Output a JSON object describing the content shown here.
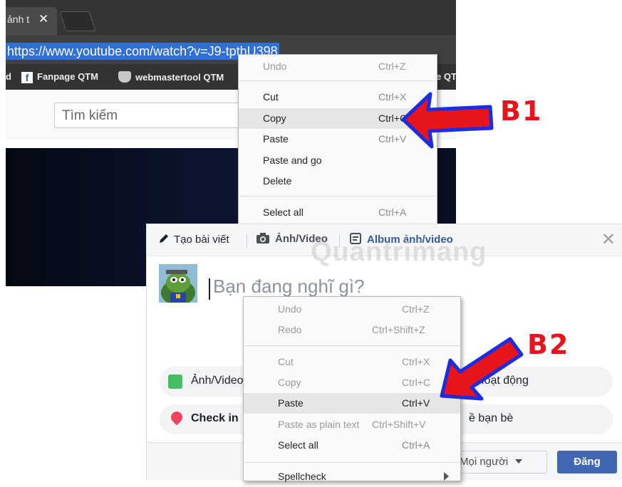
{
  "browser": {
    "tab_title": "ảnh t",
    "tab_close": "✕",
    "url": "https://www.youtube.com/watch?v=J9-tpthU398",
    "bookmarks": [
      {
        "label": "d"
      },
      {
        "label": "Fanpage QTM"
      },
      {
        "label": "webmastertool QTM"
      },
      {
        "label": "e QT"
      }
    ],
    "youtube_search_placeholder": "Tìm kiếm"
  },
  "menu1": {
    "items": {
      "undo": {
        "label": "Undo",
        "shortcut": "Ctrl+Z"
      },
      "cut": {
        "label": "Cut",
        "shortcut": "Ctrl+X"
      },
      "copy": {
        "label": "Copy",
        "shortcut": "Ctrl+C"
      },
      "paste": {
        "label": "Paste",
        "shortcut": "Ctrl+V"
      },
      "paste_go": {
        "label": "Paste and go"
      },
      "delete": {
        "label": "Delete"
      },
      "select_all": {
        "label": "Select all",
        "shortcut": "Ctrl+A"
      }
    }
  },
  "composer": {
    "tab_post": "Tạo bài viết",
    "tab_photo": "Ảnh/Video",
    "tab_album": "Album ảnh/video",
    "close": "✕",
    "placeholder": "Bạn đang nghĩ gì?",
    "pill_photo": "Ảnh/Video",
    "pill_activity": "Hoạt động",
    "pill_checkin": "Check in",
    "pill_tag": "ề bạn bè",
    "audience": "Mọi người",
    "post_button": "Đăng"
  },
  "menu2": {
    "items": {
      "undo": {
        "label": "Undo",
        "shortcut": "Ctrl+Z"
      },
      "redo": {
        "label": "Redo",
        "shortcut": "Ctrl+Shift+Z"
      },
      "cut": {
        "label": "Cut",
        "shortcut": "Ctrl+X"
      },
      "copy": {
        "label": "Copy",
        "shortcut": "Ctrl+C"
      },
      "paste": {
        "label": "Paste",
        "shortcut": "Ctrl+V"
      },
      "paste_plain": {
        "label": "Paste as plain text",
        "shortcut": "Ctrl+Shift+V"
      },
      "select_all": {
        "label": "Select all",
        "shortcut": "Ctrl+A"
      },
      "spellcheck": {
        "label": "Spellcheck"
      }
    }
  },
  "annotations": {
    "step1": "B1",
    "step2": "B2",
    "watermark": "Quantrimang"
  },
  "colors": {
    "arrow_fill": "#e8141c",
    "arrow_outline": "#1a2ee0",
    "facebook_blue": "#4267b2",
    "url_highlight": "#2f6fd6"
  }
}
